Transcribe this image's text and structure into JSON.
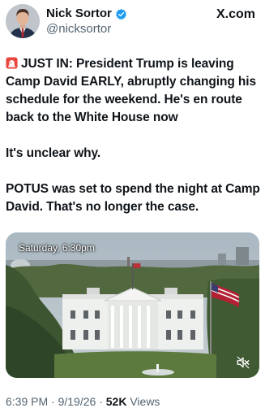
{
  "author": {
    "display_name": "Nick Sortor",
    "handle": "@nicksortor",
    "verified_icon": "verified-badge-icon"
  },
  "site": {
    "label": "X.com"
  },
  "tweet": {
    "paragraph_1": "JUST IN: President Trump is leaving Camp David EARLY, abruptly changing his schedule for the weekend. He's en route back to the White House now",
    "paragraph_2": "It's unclear why.",
    "paragraph_3": "POTUS was set to spend the night at Camp David. That's no longer the case.",
    "lead_icon": "siren-icon"
  },
  "media": {
    "overlay_text": "Saturday, 6:30pm",
    "mute_icon": "muted-speaker-icon"
  },
  "meta": {
    "time": "6:39 PM",
    "separator_1": " · ",
    "date": "9/19/26",
    "separator_2": " · ",
    "views_count": "52K",
    "views_label": " Views"
  },
  "colors": {
    "verified_blue": "#1d9bf0",
    "secondary_text": "#536471",
    "primary_text": "#0f1419"
  }
}
